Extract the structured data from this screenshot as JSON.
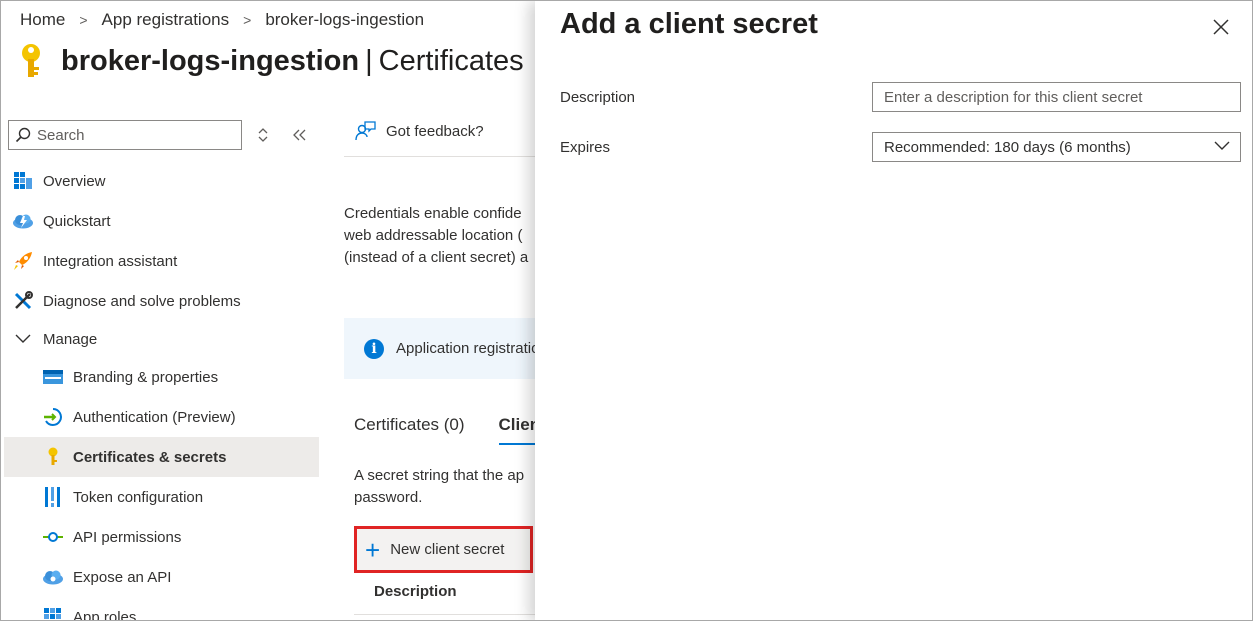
{
  "breadcrumb": {
    "home": "Home",
    "app_registrations": "App registrations",
    "current": "broker-logs-ingestion"
  },
  "page": {
    "app_name": "broker-logs-ingestion",
    "separator": "|",
    "section": "Certificates"
  },
  "sidebar": {
    "search_placeholder": "Search",
    "items": [
      {
        "label": "Overview",
        "icon": "overview-grid-icon"
      },
      {
        "label": "Quickstart",
        "icon": "cloud-bolt-icon"
      },
      {
        "label": "Integration assistant",
        "icon": "rocket-icon"
      },
      {
        "label": "Diagnose and solve problems",
        "icon": "wrench-icon"
      }
    ],
    "manage_label": "Manage",
    "manage_items": [
      {
        "label": "Branding & properties",
        "icon": "branding-icon"
      },
      {
        "label": "Authentication (Preview)",
        "icon": "authentication-icon"
      },
      {
        "label": "Certificates & secrets",
        "icon": "key-icon",
        "active": true
      },
      {
        "label": "Token configuration",
        "icon": "token-bars-icon"
      },
      {
        "label": "API permissions",
        "icon": "api-arrow-icon"
      },
      {
        "label": "Expose an API",
        "icon": "cloud-icon"
      },
      {
        "label": "App roles",
        "icon": "grid-icon"
      }
    ]
  },
  "content": {
    "feedback": "Got feedback?",
    "description_lines": [
      "Credentials enable confide",
      "web addressable location (",
      "(instead of a client secret) a"
    ],
    "banner_text": "Application registratio",
    "tabs": [
      "Certificates (0)",
      "Clien"
    ],
    "secret_desc_lines": [
      "A secret string that the ap",
      "password."
    ],
    "new_secret_label": "New client secret",
    "table_header_description": "Description"
  },
  "blade": {
    "title": "Add a client secret",
    "description_label": "Description",
    "description_placeholder": "Enter a description for this client secret",
    "expires_label": "Expires",
    "expires_value": "Recommended: 180 days (6 months)"
  },
  "colors": {
    "accent": "#0078d4",
    "highlight_border": "#e02424",
    "active_nav_bg": "#edebe9",
    "banner_bg": "#eff6fc"
  }
}
